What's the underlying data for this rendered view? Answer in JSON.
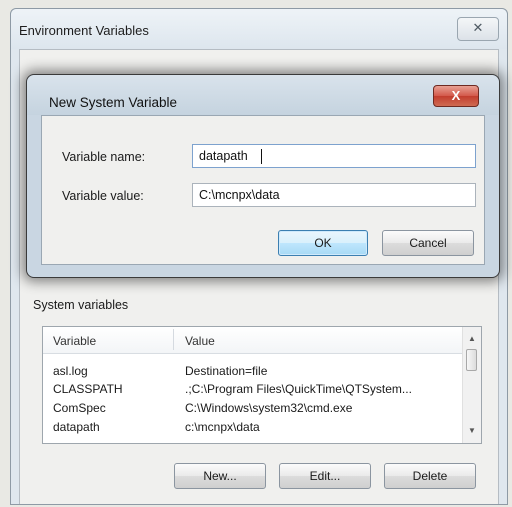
{
  "env_window": {
    "title": "Environment Variables",
    "close_glyph": "✕",
    "system_group_label": "System variables",
    "columns": {
      "variable": "Variable",
      "value": "Value"
    },
    "rows": [
      {
        "variable": "asl.log",
        "value": "Destination=file"
      },
      {
        "variable": "CLASSPATH",
        "value": ".;C:\\Program Files\\QuickTime\\QTSystem..."
      },
      {
        "variable": "ComSpec",
        "value": "C:\\Windows\\system32\\cmd.exe"
      },
      {
        "variable": "datapath",
        "value": "c:\\mcnpx\\data"
      }
    ],
    "buttons": {
      "new": "New...",
      "edit": "Edit...",
      "delete": "Delete"
    }
  },
  "dialog": {
    "title": "New System Variable",
    "close_glyph": "X",
    "name_label": "Variable name:",
    "name_value": "datapath",
    "value_label": "Variable value:",
    "value_value": "C:\\mcnpx\\data",
    "ok_label": "OK",
    "cancel_label": "Cancel"
  },
  "icons": {
    "scroll_up": "▲",
    "scroll_down": "▼"
  },
  "colors": {
    "dialog_close_red": "#c94a3a",
    "ok_button_blue": "#bee6fd",
    "dialog_frame": "#c9d6e2"
  }
}
